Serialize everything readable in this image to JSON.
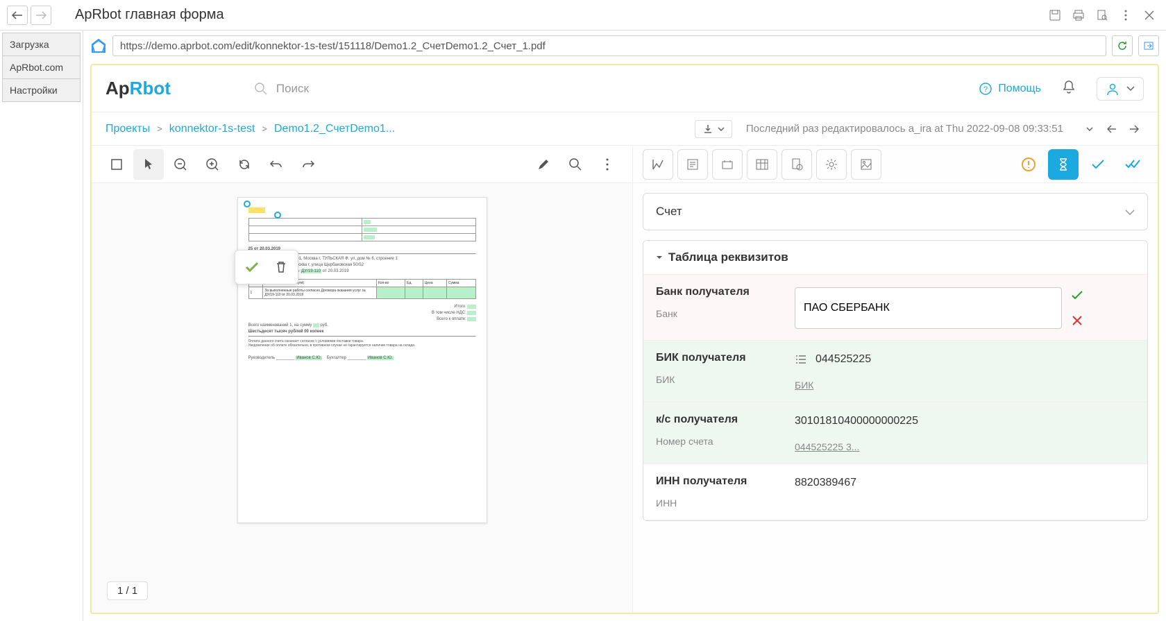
{
  "chrome": {
    "title": "ApRbot главная форма"
  },
  "left_tabs": [
    "Загрузка",
    "ApRbot.com",
    "Настройки"
  ],
  "url": "https://demo.aprbot.com/edit/konnektor-1s-test/151118/Demo1.2_СчетDemo1.2_Счет_1.pdf",
  "logo": {
    "part1": "Ap",
    "part2": "Rbot"
  },
  "search_placeholder": "Поиск",
  "help_label": "Помощь",
  "breadcrumbs": {
    "p1": "Проекты",
    "p2": "konnektor-1s-test",
    "p3": "Demo1.2_СчетDemo1..."
  },
  "last_edit": "Последний раз редактировалось a_ira at Thu 2022-09-08 09:33:51",
  "page_counter": "1 / 1",
  "accordion": {
    "section1_title": "Счет",
    "section2_title": "Таблица реквизитов"
  },
  "fields": [
    {
      "label_main": "Банк получателя",
      "label_sub": "Банк",
      "value": "ПАО СБЕРБАНК",
      "editing": true
    },
    {
      "label_main": "БИК получателя",
      "label_sub": "БИК",
      "value": "044525225",
      "sublink": "БИК",
      "highlighted": true,
      "icon": true
    },
    {
      "label_main": "к/с получателя",
      "label_sub": "Номер счета",
      "value": "30101810400000000225",
      "sublink": "044525225 3...",
      "highlighted": true
    },
    {
      "label_main": "ИНН получателя",
      "label_sub": "ИНН",
      "value": "8820389467"
    }
  ],
  "doc_preview": {
    "invoice_line": "25 от 20.03.2019",
    "supplier": "ООО «АльСервис», 119991, Москва г, ТУЛЬСКАЯ Ф. ул, дом № 6, строение 1",
    "buyer": "ООО «Парус», 109147 Москва г, улица Щербаковская 50/52",
    "basis_prefix": "Договор оказания услуг № ",
    "basis_num": "ДУ/19-110",
    "basis_suffix": " от 20.03.2019"
  }
}
